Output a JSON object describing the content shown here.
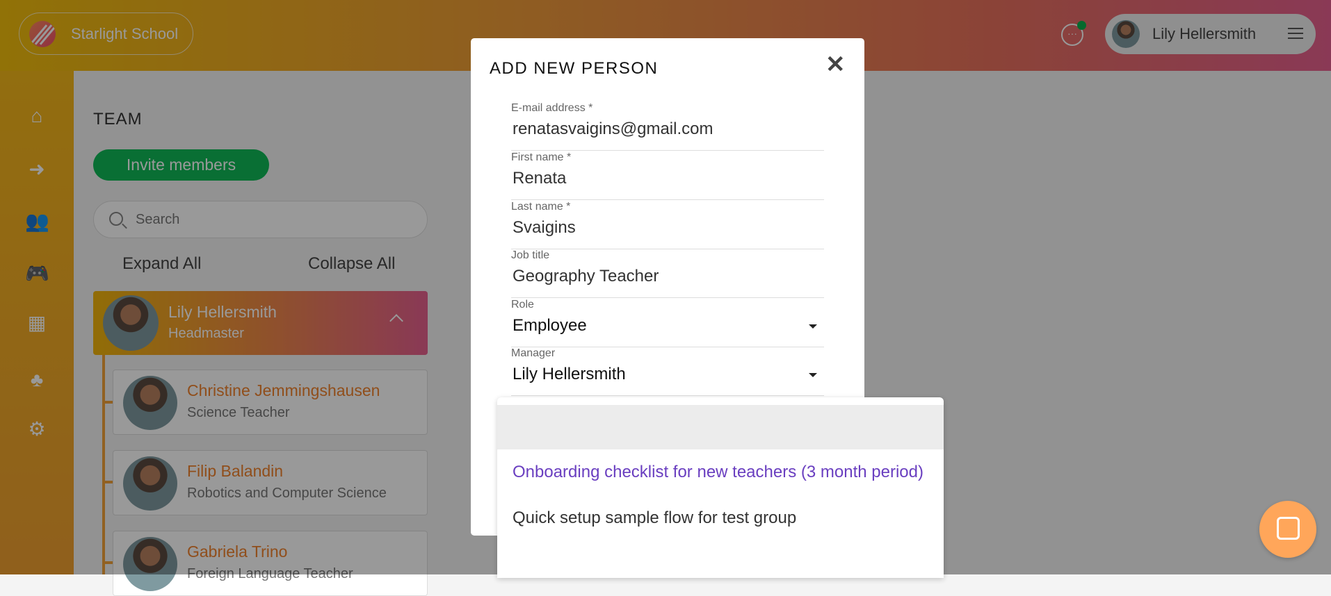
{
  "header": {
    "school_name": "Starlight School",
    "user_name": "Lily Hellersmith",
    "icons": {
      "chat": "chat-bubble-icon",
      "menu": "hamburger-menu-icon"
    }
  },
  "sidebar": {
    "icons": [
      "home-icon",
      "arrow-right-circle-icon",
      "users-icon",
      "gamepad-icon",
      "presentation-icon",
      "org-chart-icon",
      "gear-icon"
    ],
    "active": "org-chart-icon"
  },
  "team": {
    "title": "TEAM",
    "invite_label": "Invite members",
    "search_placeholder": "Search",
    "expand_label": "Expand All",
    "collapse_label": "Collapse All",
    "lead": {
      "name": "Lily Hellersmith",
      "job": "Headmaster"
    },
    "members": [
      {
        "name": "Christine Jemmingshausen",
        "job": "Science Teacher"
      },
      {
        "name": "Filip Balandin",
        "job": "Robotics and Computer Science"
      },
      {
        "name": "Gabriela Trino",
        "job": "Foreign Language Teacher"
      }
    ]
  },
  "modal": {
    "title": "ADD NEW PERSON",
    "fields": [
      {
        "label": "E-mail address *",
        "value": "renatasvaigins@gmail.com"
      },
      {
        "label": "First name *",
        "value": "Renata"
      },
      {
        "label": "Last name *",
        "value": "Svaigins"
      },
      {
        "label": "Job title",
        "value": "Geography Teacher"
      },
      {
        "label": "Role",
        "value": "Employee"
      },
      {
        "label": "Manager",
        "value": "Lily Hellersmith"
      }
    ],
    "dropdown_options": [
      "Onboarding checklist for new teachers (3 month period)",
      "Quick setup sample flow for test group"
    ]
  },
  "colors": {
    "accent_green": "#10b957",
    "highlight_option": "#6a3fc0",
    "member_name": "#f0832d",
    "chat_widget": "#ffa65a"
  }
}
